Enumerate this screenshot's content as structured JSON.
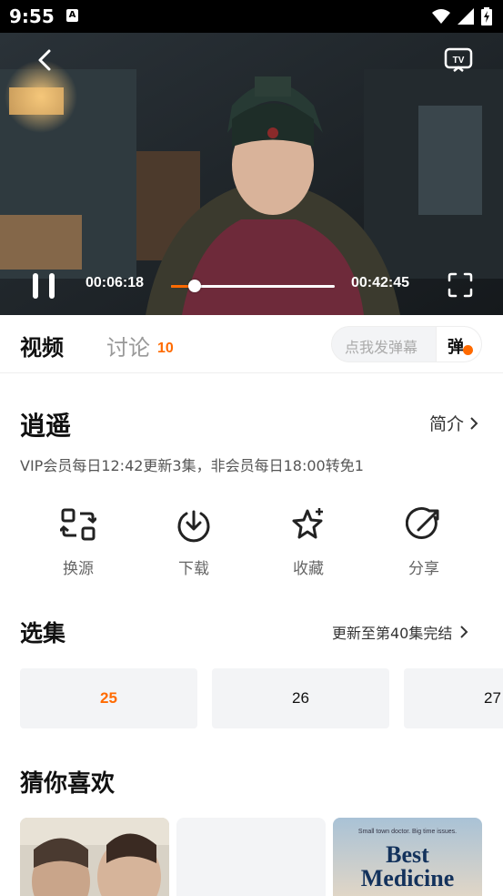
{
  "status_bar": {
    "time": "9:55",
    "notif_letter": "A"
  },
  "player": {
    "current_time": "00:06:18",
    "duration": "00:42:45",
    "progress_percent": 14.7,
    "colors": {
      "accent": "#ff6a00"
    }
  },
  "tabs": {
    "video": "视频",
    "discussion": "讨论",
    "discussion_count": "10",
    "danmaku_placeholder": "点我发弹幕",
    "danmaku_button": "弹"
  },
  "info": {
    "title": "逍遥",
    "intro_label": "简介",
    "schedule": "VIP会员每日12:42更新3集，非会员每日18:00转免1"
  },
  "actions": [
    {
      "label": "换源",
      "icon": "switch-source-icon"
    },
    {
      "label": "下载",
      "icon": "download-icon"
    },
    {
      "label": "收藏",
      "icon": "star-icon"
    },
    {
      "label": "分享",
      "icon": "share-icon"
    }
  ],
  "episodes": {
    "title": "选集",
    "more": "更新至第40集完结",
    "items": [
      "25",
      "26",
      "27"
    ],
    "active": "25"
  },
  "recommend": {
    "title": "猜你喜欢",
    "cards": [
      {
        "name": "rec-card-1",
        "tag": "",
        "line1": "",
        "line2": ""
      },
      {
        "name": "rec-card-2",
        "tag": "",
        "line1": "",
        "line2": ""
      },
      {
        "name": "rec-card-3",
        "tag": "Small town doctor. Big time issues.",
        "line1": "Best",
        "line2": "Medicine"
      }
    ]
  }
}
